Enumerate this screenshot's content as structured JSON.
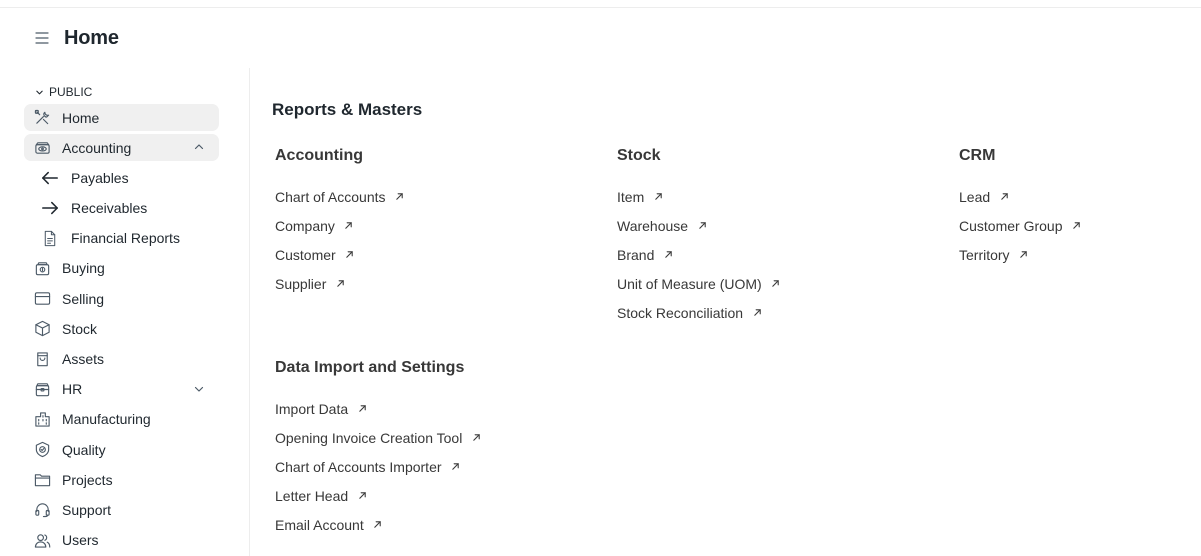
{
  "page": {
    "title": "Home"
  },
  "sidebar": {
    "section": "PUBLIC",
    "items": [
      {
        "label": "Home"
      },
      {
        "label": "Accounting"
      },
      {
        "label": "Payables"
      },
      {
        "label": "Receivables"
      },
      {
        "label": "Financial Reports"
      },
      {
        "label": "Buying"
      },
      {
        "label": "Selling"
      },
      {
        "label": "Stock"
      },
      {
        "label": "Assets"
      },
      {
        "label": "HR"
      },
      {
        "label": "Manufacturing"
      },
      {
        "label": "Quality"
      },
      {
        "label": "Projects"
      },
      {
        "label": "Support"
      },
      {
        "label": "Users"
      }
    ]
  },
  "main": {
    "heading": "Reports & Masters",
    "cards": [
      {
        "title": "Accounting",
        "links": [
          "Chart of Accounts",
          "Company",
          "Customer",
          "Supplier"
        ]
      },
      {
        "title": "Stock",
        "links": [
          "Item",
          "Warehouse",
          "Brand",
          "Unit of Measure (UOM)",
          "Stock Reconciliation"
        ]
      },
      {
        "title": "CRM",
        "links": [
          "Lead",
          "Customer Group",
          "Territory"
        ]
      },
      {
        "title": "Data Import and Settings",
        "links": [
          "Import Data",
          "Opening Invoice Creation Tool",
          "Chart of Accounts Importer",
          "Letter Head",
          "Email Account"
        ]
      }
    ]
  },
  "icons": {
    "menu": "hamburger-icon",
    "home": "tools-icon",
    "accounting": "money-eye-icon",
    "payables": "arrow-left-icon",
    "receivables": "arrow-right-icon",
    "financial_reports": "document-icon",
    "buying": "purchase-icon",
    "selling": "card-icon",
    "stock": "cube-icon",
    "assets": "bag-icon",
    "hr": "briefcase-icon",
    "manufacturing": "factory-icon",
    "quality": "badge-icon",
    "projects": "folder-icon",
    "support": "headset-icon",
    "users": "users-icon",
    "link": "arrow-up-right-icon"
  }
}
